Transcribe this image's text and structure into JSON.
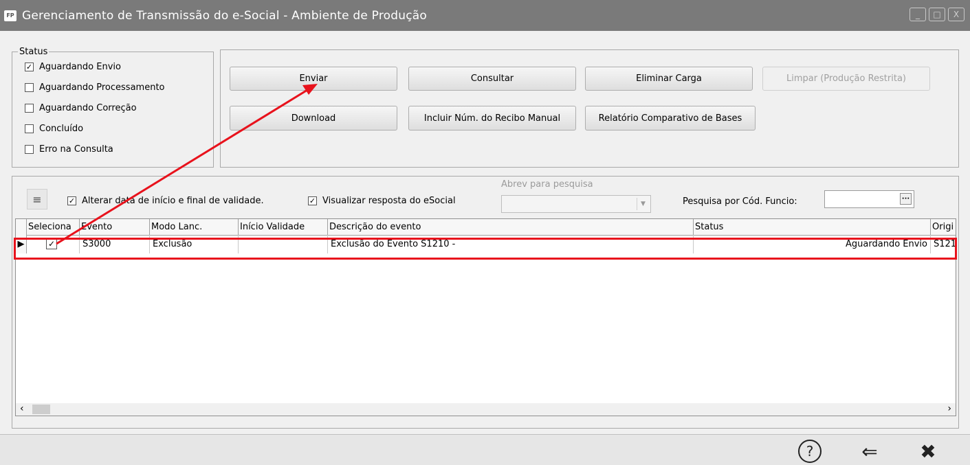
{
  "window": {
    "app_icon": "FP",
    "title": "Gerenciamento de Transmissão do e-Social - Ambiente de Produção",
    "minimize_icon": "_",
    "maximize_icon": "□",
    "close_icon": "X"
  },
  "status_group": {
    "legend": "Status",
    "items": [
      {
        "label": "Aguardando Envio",
        "checked": "✓"
      },
      {
        "label": "Aguardando Processamento",
        "checked": ""
      },
      {
        "label": "Aguardando Correção",
        "checked": ""
      },
      {
        "label": "Concluído",
        "checked": ""
      },
      {
        "label": "Erro na Consulta",
        "checked": ""
      }
    ]
  },
  "buttons": {
    "enviar": "Enviar",
    "consultar": "Consultar",
    "eliminar_carga": "Eliminar Carga",
    "limpar": "Limpar (Produção Restrita)",
    "download": "Download",
    "incluir_recibo": "Incluir Núm. do Recibo Manual",
    "relatorio": "Relatório Comparativo de Bases"
  },
  "grid_toolbar": {
    "select_icon": "≡",
    "alterar_data": {
      "label": "Alterar data de início e final de validade.",
      "checked": "✓"
    },
    "visualizar_resposta": {
      "label": "Visualizar resposta do eSocial",
      "checked": "✓"
    },
    "abrev_label": "Abrev para pesquisa",
    "abrev_value": "",
    "pesquisa_label": "Pesquisa por Cód. Funcio:",
    "pesquisa_value": "",
    "pesquisa_button": "···"
  },
  "grid": {
    "columns": [
      "Seleciona",
      "Evento",
      "Modo Lanc.",
      "Início Validade",
      "Descrição do evento",
      "Status",
      "Origi"
    ],
    "rows": [
      {
        "selected": "✓",
        "evento": "S3000",
        "modo": "Exclusão",
        "inicio": "",
        "descricao": "Exclusão do Evento S1210 -",
        "status": "Aguardando Envio",
        "origem": "S121"
      }
    ],
    "row_indicator": "▶",
    "scroll_left": "‹",
    "scroll_right": "›"
  },
  "footer": {
    "help_icon": "?",
    "back_icon": "⇐",
    "close_icon": "✖"
  },
  "colors": {
    "titlebar": "#7a7a7a",
    "annotation": "#e8121c"
  }
}
